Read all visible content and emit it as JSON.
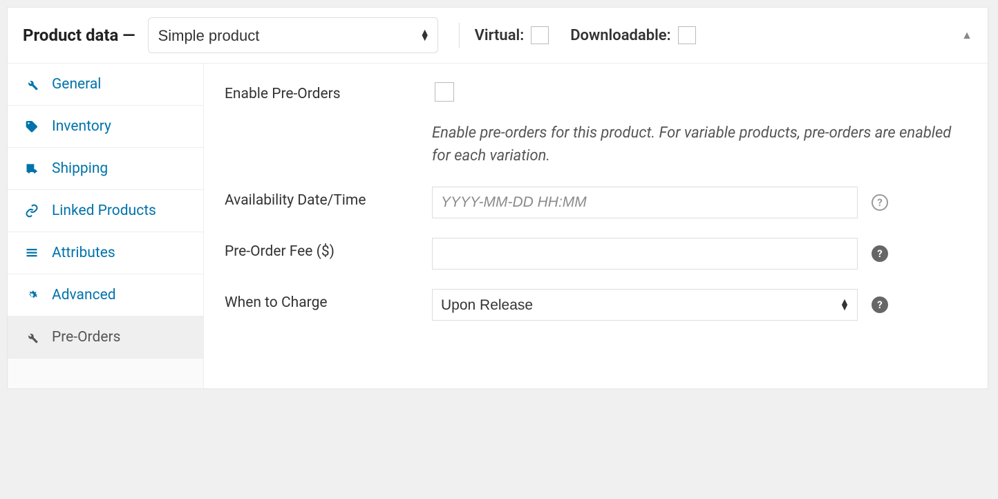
{
  "header": {
    "title": "Product data —",
    "product_type": "Simple product",
    "virtual_label": "Virtual:",
    "downloadable_label": "Downloadable:"
  },
  "tabs": [
    {
      "key": "general",
      "label": "General",
      "icon": "wrench"
    },
    {
      "key": "inventory",
      "label": "Inventory",
      "icon": "tag"
    },
    {
      "key": "shipping",
      "label": "Shipping",
      "icon": "truck"
    },
    {
      "key": "linked",
      "label": "Linked Products",
      "icon": "link"
    },
    {
      "key": "attributes",
      "label": "Attributes",
      "icon": "list"
    },
    {
      "key": "advanced",
      "label": "Advanced",
      "icon": "gear"
    },
    {
      "key": "preorders",
      "label": "Pre-Orders",
      "icon": "wrench",
      "active": true
    }
  ],
  "fields": {
    "enable": {
      "label": "Enable Pre-Orders",
      "hint": "Enable pre-orders for this product. For variable products, pre-orders are enabled for each variation."
    },
    "availability": {
      "label": "Availability Date/Time",
      "placeholder": "YYYY-MM-DD HH:MM",
      "value": ""
    },
    "fee": {
      "label": "Pre-Order Fee ($)",
      "value": ""
    },
    "charge": {
      "label": "When to Charge",
      "value": "Upon Release"
    }
  }
}
